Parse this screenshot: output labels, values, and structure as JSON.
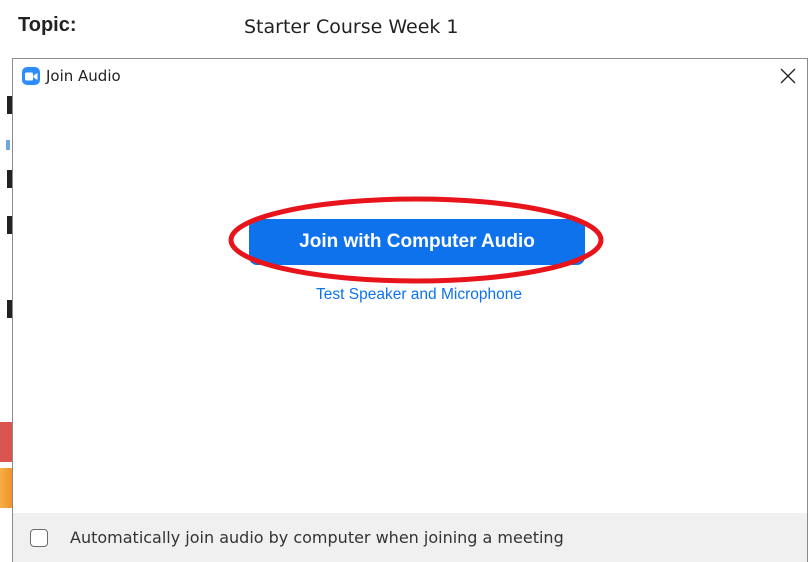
{
  "background": {
    "topic_label": "Topic:",
    "topic_value": "Starter Course Week 1"
  },
  "dialog": {
    "title": "Join Audio",
    "app_icon": "zoom-camera-icon",
    "close_icon": "close-icon",
    "primary_button_label": "Join with Computer Audio",
    "secondary_link_label": "Test Speaker and Microphone",
    "footer": {
      "checkbox_checked": false,
      "checkbox_label": "Automatically join audio by computer when joining a meeting"
    }
  },
  "colors": {
    "accent_blue": "#0e72ed",
    "annotation_red": "#e8141c",
    "footer_bg": "#f0f0f0"
  }
}
